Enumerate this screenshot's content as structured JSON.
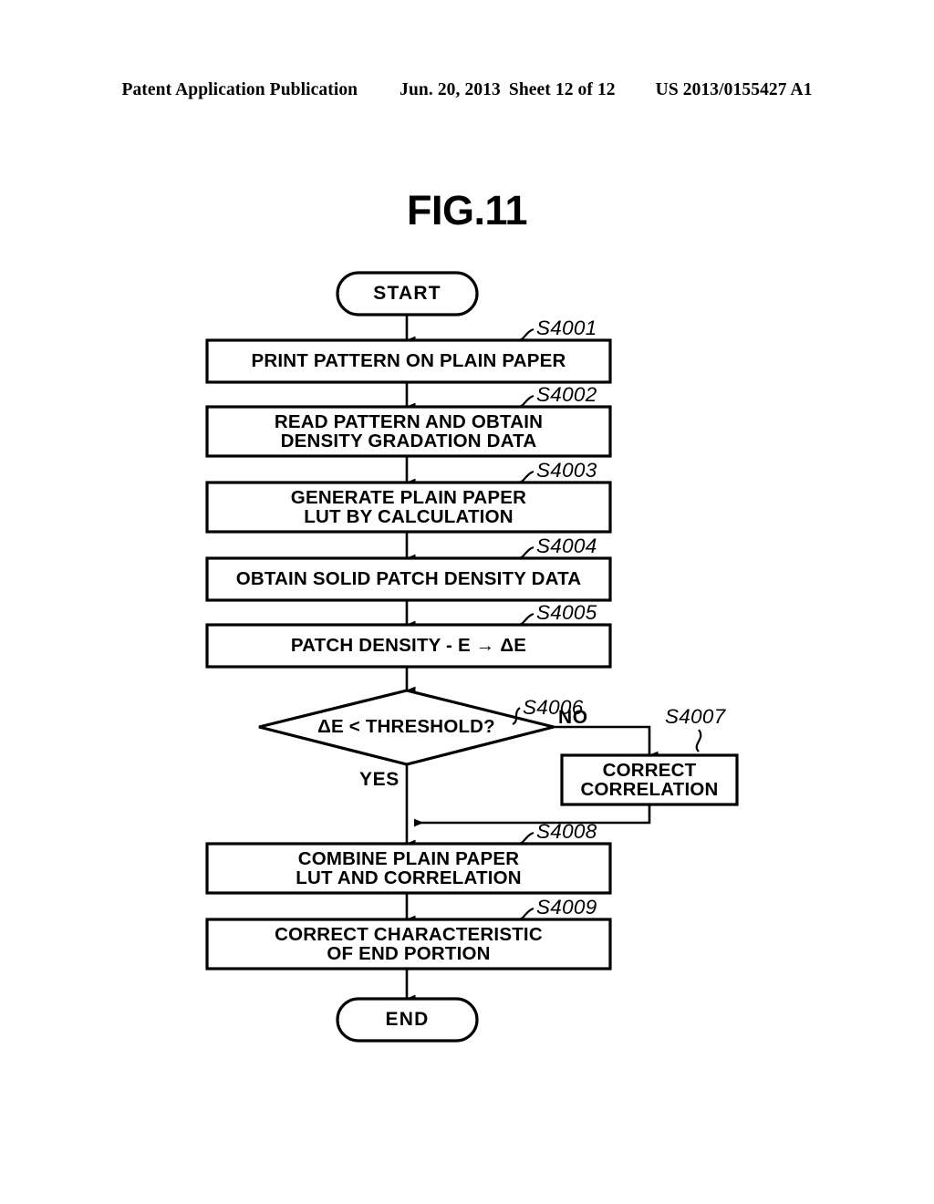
{
  "header": {
    "publication": "Patent Application Publication",
    "date": "Jun. 20, 2013",
    "sheet": "Sheet 12 of 12",
    "patent_number": "US 2013/0155427 A1"
  },
  "figure": {
    "title": "FIG.11"
  },
  "flowchart": {
    "start_label": "START",
    "end_label": "END",
    "yes_label": "YES",
    "no_label": "NO",
    "steps": [
      {
        "ref": "S4001",
        "lines": [
          "PRINT PATTERN ON PLAIN PAPER"
        ]
      },
      {
        "ref": "S4002",
        "lines": [
          "READ PATTERN AND OBTAIN",
          "DENSITY GRADATION DATA"
        ]
      },
      {
        "ref": "S4003",
        "lines": [
          "GENERATE PLAIN PAPER",
          "LUT BY CALCULATION"
        ]
      },
      {
        "ref": "S4004",
        "lines": [
          "OBTAIN SOLID PATCH DENSITY DATA"
        ]
      },
      {
        "ref": "S4005",
        "lines": [
          "PATCH DENSITY - E → ΔE"
        ]
      },
      {
        "ref": "S4006",
        "lines": [
          "ΔE < THRESHOLD?"
        ]
      },
      {
        "ref": "S4007",
        "lines": [
          "CORRECT",
          "CORRELATION"
        ]
      },
      {
        "ref": "S4008",
        "lines": [
          "COMBINE PLAIN PAPER",
          "LUT AND CORRELATION"
        ]
      },
      {
        "ref": "S4009",
        "lines": [
          "CORRECT CHARACTERISTIC",
          "OF END PORTION"
        ]
      }
    ]
  },
  "colors": {
    "ink": "#000000",
    "paper": "#ffffff"
  }
}
